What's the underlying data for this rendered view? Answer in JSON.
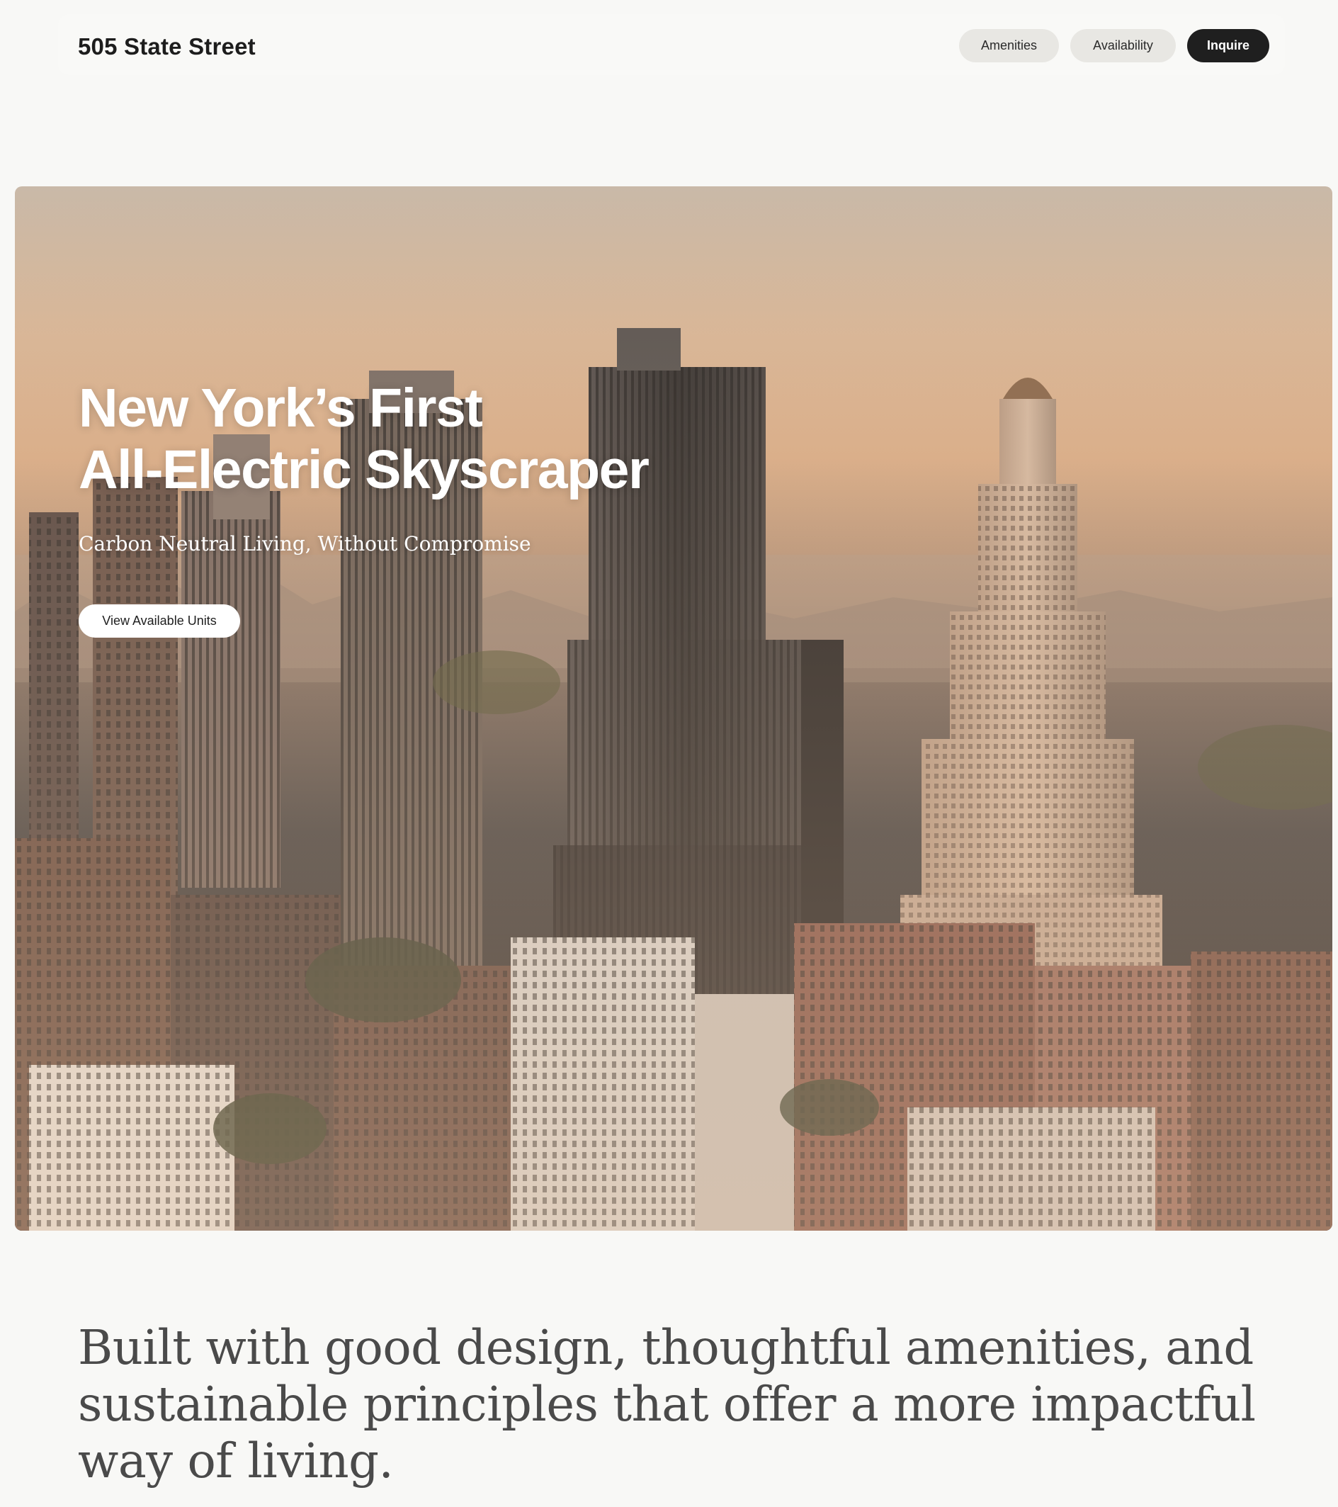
{
  "header": {
    "brand": "505 State Street",
    "nav": {
      "amenities": "Amenities",
      "availability": "Availability",
      "inquire": "Inquire"
    }
  },
  "hero": {
    "title_line1": "New York’s First",
    "title_line2": "All-Electric Skyscraper",
    "subtitle": "Carbon Neutral Living, Without Compromise",
    "cta": "View Available Units",
    "image_subject": "aerial-city-skyline-at-sunset"
  },
  "statement": {
    "text": "Built with good design, thoughtful amenities, and sustainable principles that offer a more impactful way of living."
  },
  "colors": {
    "page_bg": "#f8f8f6",
    "pill_bg": "#e8e7e3",
    "dark_button": "#1f1f1f",
    "statement_text": "#4a4a4a"
  }
}
